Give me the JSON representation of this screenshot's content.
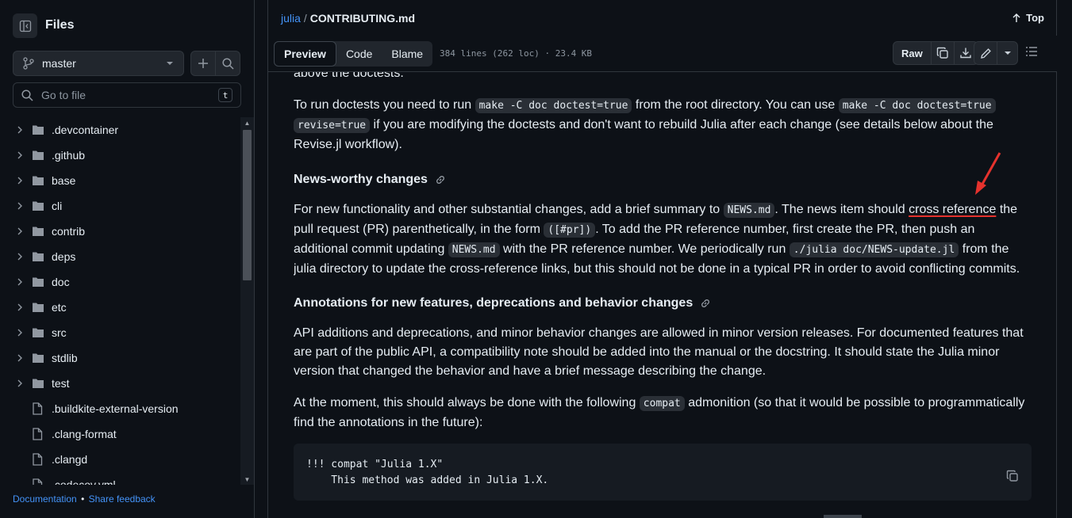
{
  "sidebar": {
    "title": "Files",
    "branch": "master",
    "goto_placeholder": "Go to file",
    "goto_shortcut": "t",
    "tree": [
      {
        "name": ".devcontainer",
        "type": "dir"
      },
      {
        "name": ".github",
        "type": "dir"
      },
      {
        "name": "base",
        "type": "dir"
      },
      {
        "name": "cli",
        "type": "dir"
      },
      {
        "name": "contrib",
        "type": "dir"
      },
      {
        "name": "deps",
        "type": "dir"
      },
      {
        "name": "doc",
        "type": "dir"
      },
      {
        "name": "etc",
        "type": "dir"
      },
      {
        "name": "src",
        "type": "dir"
      },
      {
        "name": "stdlib",
        "type": "dir"
      },
      {
        "name": "test",
        "type": "dir"
      },
      {
        "name": ".buildkite-external-version",
        "type": "file"
      },
      {
        "name": ".clang-format",
        "type": "file"
      },
      {
        "name": ".clangd",
        "type": "file"
      },
      {
        "name": ".codecov.yml",
        "type": "file"
      }
    ],
    "footer": {
      "documentation": "Documentation",
      "separator": "•",
      "feedback": "Share feedback"
    }
  },
  "header": {
    "repo": "julia",
    "separator": "/",
    "file": "CONTRIBUTING.md",
    "top_label": "Top"
  },
  "toolbar": {
    "tabs": [
      "Preview",
      "Code",
      "Blame"
    ],
    "active_tab": "Preview",
    "meta": "384 lines (262 loc) · 23.4 KB",
    "raw_label": "Raw"
  },
  "content": {
    "cut_line": "above the doctests.",
    "p1": {
      "a": "To run doctests you need to run ",
      "code1": "make -C doc doctest=true",
      "b": " from the root directory. You can use ",
      "code2a": "make -C doc doctest=true",
      "code2b": "revise=true",
      "c": " if you are modifying the doctests and don't want to rebuild Julia after each change (see details below about the Revise.jl workflow)."
    },
    "h_news": "News-worthy changes",
    "p2": {
      "a": "For new functionality and other substantial changes, add a brief summary to ",
      "code1": "NEWS.md",
      "b": ". The news item should ",
      "underlined": "cross reference",
      "c": " the pull request (PR) parenthetically, in the form ",
      "code2": "([#pr])",
      "d": ". To add the PR reference number, first create the PR, then push an additional commit updating ",
      "code3": "NEWS.md",
      "e": " with the PR reference number. We periodically run ",
      "code4": "./julia doc/NEWS-update.jl",
      "f": " from the julia directory to update the cross-reference links, but this should not be done in a typical PR in order to avoid conflicting commits."
    },
    "h_annot": "Annotations for new features, deprecations and behavior changes",
    "p3": "API additions and deprecations, and minor behavior changes are allowed in minor version releases. For documented features that are part of the public API, a compatibility note should be added into the manual or the docstring. It should state the Julia minor version that changed the behavior and have a brief message describing the change.",
    "p4": {
      "a": "At the moment, this should always be done with the following ",
      "code1": "compat",
      "b": " admonition (so that it would be possible to programmatically find the annotations in the future):"
    },
    "codeblock": "!!! compat \"Julia 1.X\"\n    This method was added in Julia 1.X."
  },
  "colors": {
    "accent": "#4493f8",
    "annotation": "#e5322d",
    "background": "#0d1117"
  }
}
